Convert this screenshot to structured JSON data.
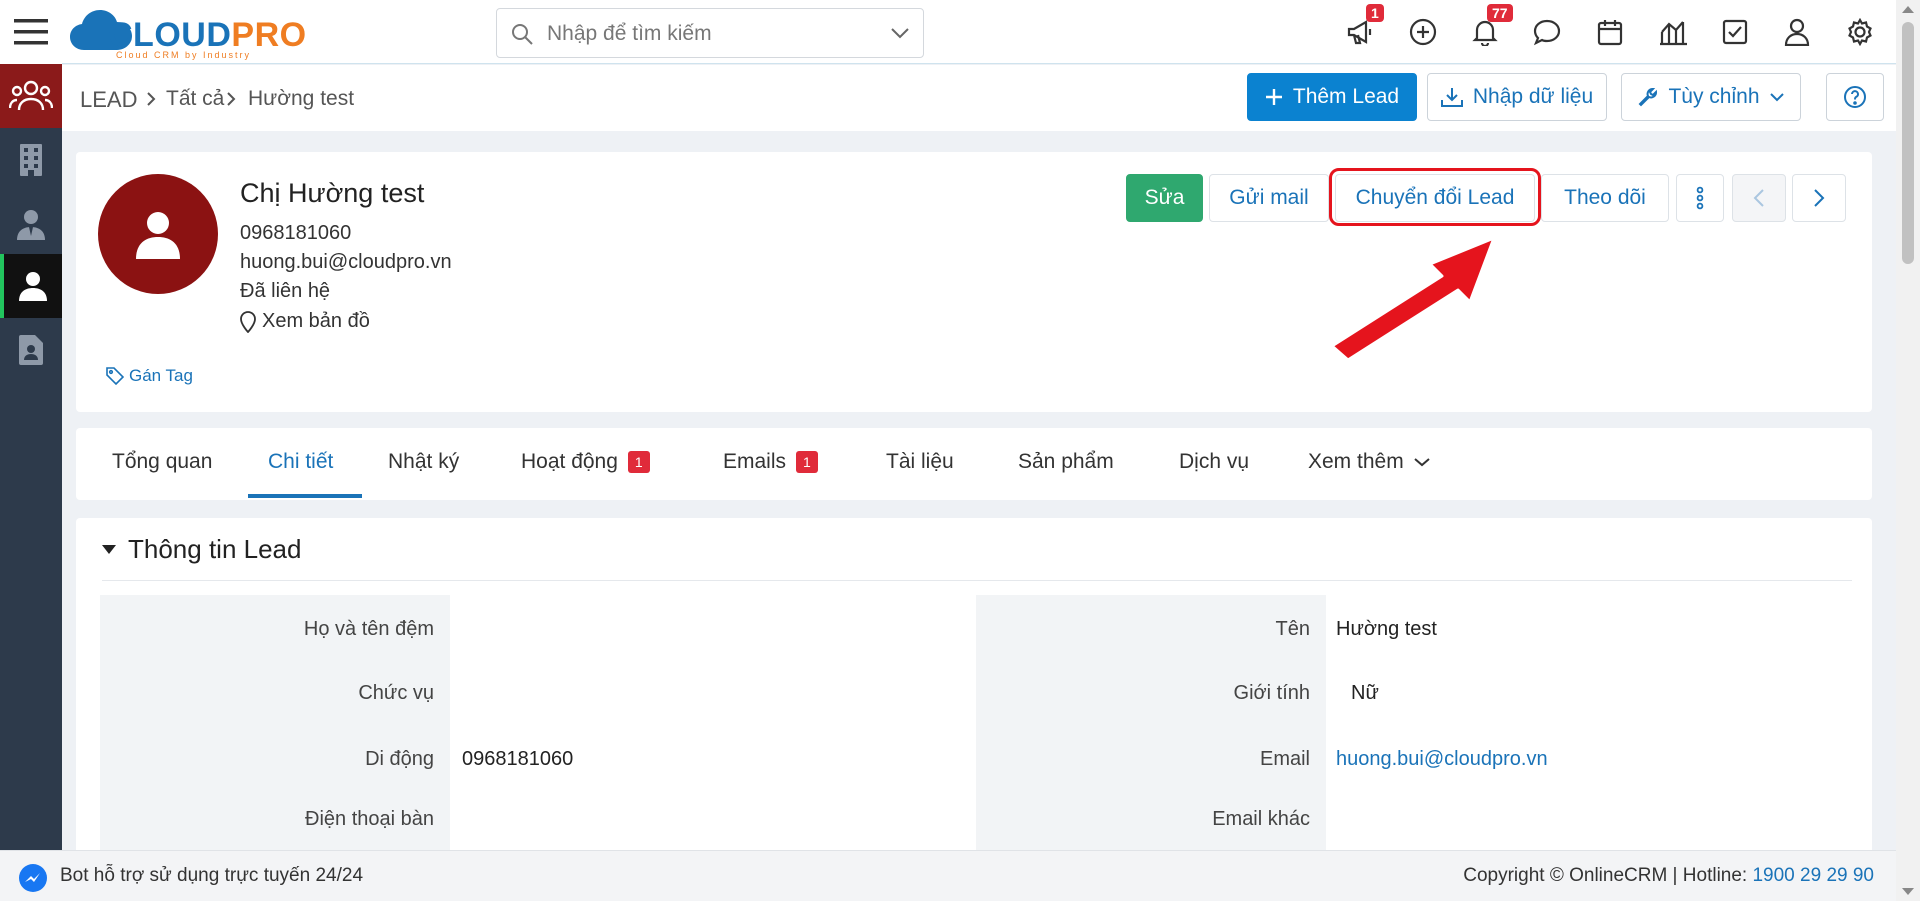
{
  "header": {
    "logo_text_a": "CLOUD",
    "logo_text_b": "PRO",
    "logo_sub": "Cloud CRM by Industry",
    "search_placeholder": "Nhập để tìm kiếm",
    "announce_badge": "1",
    "notify_badge": "77"
  },
  "breadcrumb": {
    "root": "LEAD",
    "level1": "Tất cả",
    "level2": "Hường test"
  },
  "actions": {
    "add_lead": "Thêm Lead",
    "import": "Nhập dữ liệu",
    "customize": "Tùy chỉnh"
  },
  "lead": {
    "name": "Chị Hường test",
    "phone": "0968181060",
    "email": "huong.bui@cloudpro.vn",
    "status": "Đã liên hệ",
    "map_link": "Xem bản đồ",
    "tag_link": "Gán Tag"
  },
  "lead_buttons": {
    "edit": "Sửa",
    "send_mail": "Gửi mail",
    "convert": "Chuyển đổi Lead",
    "follow": "Theo dõi"
  },
  "tabs": [
    {
      "label": "Tổng quan"
    },
    {
      "label": "Chi tiết",
      "active": true
    },
    {
      "label": "Nhật ký"
    },
    {
      "label": "Hoạt động",
      "badge": "1"
    },
    {
      "label": "Emails",
      "badge": "1"
    },
    {
      "label": "Tài liệu"
    },
    {
      "label": "Sản phẩm"
    },
    {
      "label": "Dịch vụ"
    },
    {
      "label": "Xem thêm"
    }
  ],
  "details": {
    "section_title": "Thông tin Lead",
    "left_fields": [
      {
        "label": "Họ và tên đệm",
        "value": ""
      },
      {
        "label": "Chức vụ",
        "value": ""
      },
      {
        "label": "Di động",
        "value": "0968181060"
      },
      {
        "label": "Điện thoại bàn",
        "value": ""
      }
    ],
    "right_fields": [
      {
        "label": "Tên",
        "value": "Hường test"
      },
      {
        "label": "Giới tính",
        "value": "Nữ"
      },
      {
        "label": "Email",
        "value": "huong.bui@cloudpro.vn"
      },
      {
        "label": "Email khác",
        "value": ""
      }
    ]
  },
  "footer": {
    "bot_text": "Bot hỗ trợ sử dụng trực tuyến 24/24",
    "copyright": "Copyright © OnlineCRM | Hotline:",
    "hotline": "1900 29 29 90"
  },
  "colors": {
    "primary": "#0b82d0",
    "success": "#2fa86f",
    "sidebar": "#2d3a4b",
    "highlight": "#e5141d"
  }
}
